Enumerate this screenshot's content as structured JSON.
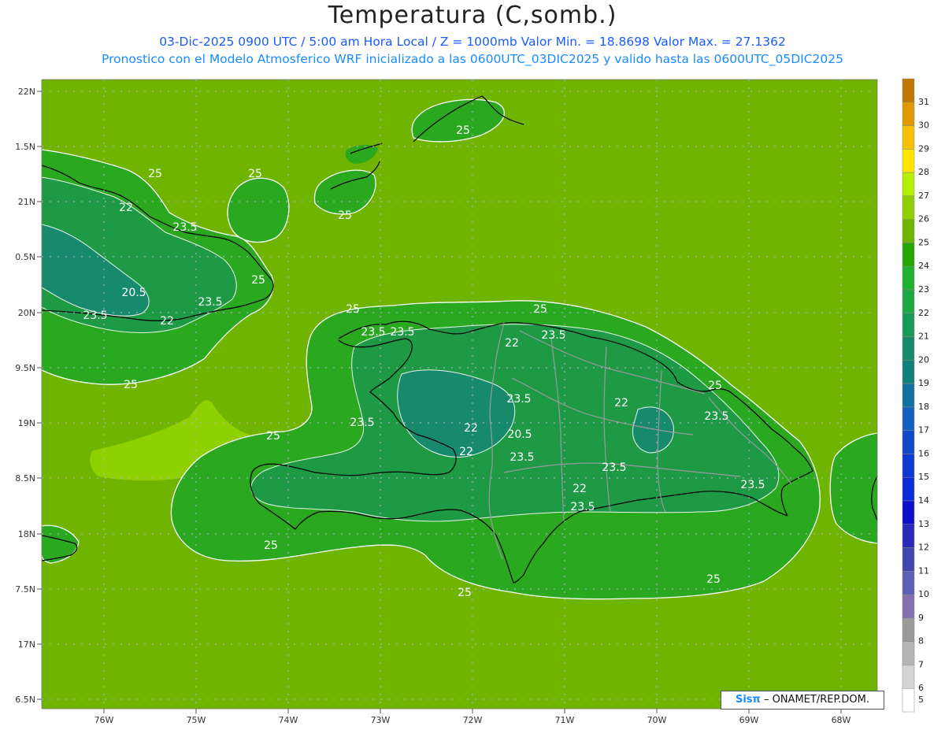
{
  "header": {
    "title": "Temperatura (C,somb.)",
    "line1": "03-Dic-2025  0900 UTC / 5:00 am Hora Local / Z = 1000mb   Valor Min. = 18.8698  Valor Max. = 27.1362",
    "line2": "Pronostico con el Modelo Atmosferico WRF inicializado a las 0600UTC_03DIC2025 y valido hasta las  0600UTC_05DIC2025"
  },
  "map": {
    "lat_labels": [
      "22N",
      "1.5N",
      "21N",
      "0.5N",
      "20N",
      "9.5N",
      "19N",
      "8.5N",
      "18N",
      "7.5N",
      "17N",
      "6.5N"
    ],
    "lon_labels": [
      "76W",
      "75W",
      "74W",
      "73W",
      "72W",
      "71W",
      "70W",
      "69W",
      "68W"
    ],
    "contour_labels": [
      "25",
      "25",
      "25",
      "25",
      "25",
      "25",
      "25",
      "25",
      "25",
      "25",
      "25",
      "25",
      "22",
      "22",
      "22",
      "22",
      "22",
      "22",
      "23.5",
      "23.5",
      "23.5",
      "23.5",
      "23.5",
      "23.5",
      "23.5",
      "23.5",
      "23.5",
      "23.5",
      "23.5",
      "23.5",
      "23.5",
      "20.5",
      "20.5",
      "25",
      "22"
    ],
    "colors": {
      "sea": "#6fb500",
      "land_low": "#2aa820",
      "land_mid": "#1e9a45",
      "land_cool": "#168a6a",
      "warm": "#8fd000",
      "contour": "#ffffff",
      "coast": "#000000",
      "border": "#9a9a9a",
      "grid": "#c8a8e8"
    }
  },
  "colorbar": {
    "levels": [
      "31",
      "30",
      "29",
      "28",
      "27",
      "26",
      "25",
      "24",
      "23",
      "22",
      "21",
      "20",
      "19",
      "18",
      "17",
      "16",
      "15",
      "14",
      "13",
      "12",
      "11",
      "10",
      "9",
      "8",
      "7",
      "6",
      "5"
    ],
    "colors": [
      "#c07800",
      "#e09a00",
      "#f5c000",
      "#ffe400",
      "#b4ef00",
      "#8fd000",
      "#6fb500",
      "#24a800",
      "#22b030",
      "#1fa845",
      "#1a9a55",
      "#168a6a",
      "#13807a",
      "#1270a0",
      "#1560c0",
      "#1148c8",
      "#0e3ad2",
      "#0a2ad8",
      "#0a10cc",
      "#2a2ab8",
      "#4048b0",
      "#5a60b0",
      "#8070b0",
      "#9a9a9a",
      "#b4b4b4",
      "#d4d4d4",
      "#ffffff"
    ]
  },
  "footer": {
    "logo_sis": "Sisπ",
    "logo_text": "– ONAMET/REP.DOM."
  }
}
